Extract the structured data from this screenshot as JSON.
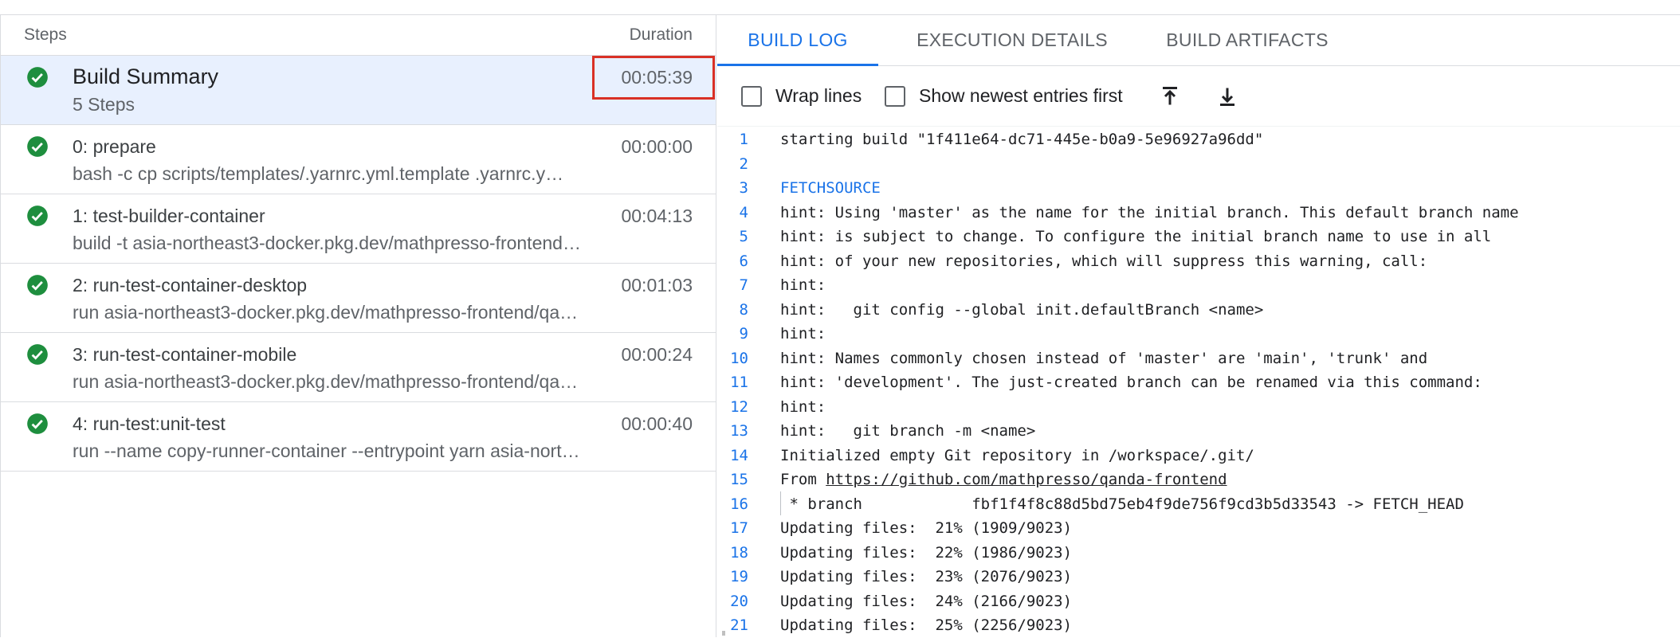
{
  "steps_panel": {
    "header_steps": "Steps",
    "header_duration": "Duration",
    "items": [
      {
        "title": "Build Summary",
        "sub": "5 Steps",
        "duration": "00:05:39"
      },
      {
        "title": "0: prepare",
        "sub": "bash -c cp scripts/templates/.yarnrc.yml.template .yarnrc.y…",
        "duration": "00:00:00"
      },
      {
        "title": "1: test-builder-container",
        "sub": "build -t asia-northeast3-docker.pkg.dev/mathpresso-frontend…",
        "duration": "00:04:13"
      },
      {
        "title": "2: run-test-container-desktop",
        "sub": "run asia-northeast3-docker.pkg.dev/mathpresso-frontend/qa…",
        "duration": "00:01:03"
      },
      {
        "title": "3: run-test-container-mobile",
        "sub": "run asia-northeast3-docker.pkg.dev/mathpresso-frontend/qa…",
        "duration": "00:00:24"
      },
      {
        "title": "4: run-test:unit-test",
        "sub": "run --name copy-runner-container --entrypoint yarn asia-north…",
        "duration": "00:00:40"
      }
    ]
  },
  "tabs": {
    "build_log": "BUILD LOG",
    "execution_details": "EXECUTION DETAILS",
    "build_artifacts": "BUILD ARTIFACTS"
  },
  "toolbar": {
    "wrap_lines": "Wrap lines",
    "show_newest": "Show newest entries first",
    "scroll_top_icon": "scroll-to-top-icon",
    "scroll_bottom_icon": "scroll-to-bottom-icon"
  },
  "log": {
    "lines": [
      {
        "n": "1",
        "text": "starting build \"1f411e64-dc71-445e-b0a9-5e96927a96dd\""
      },
      {
        "n": "2",
        "text": ""
      },
      {
        "n": "3",
        "text": "FETCHSOURCE"
      },
      {
        "n": "4",
        "text": "hint: Using 'master' as the name for the initial branch. This default branch name"
      },
      {
        "n": "5",
        "text": "hint: is subject to change. To configure the initial branch name to use in all"
      },
      {
        "n": "6",
        "text": "hint: of your new repositories, which will suppress this warning, call:"
      },
      {
        "n": "7",
        "text": "hint:"
      },
      {
        "n": "8",
        "text": "hint:   git config --global init.defaultBranch <name>"
      },
      {
        "n": "9",
        "text": "hint:"
      },
      {
        "n": "10",
        "text": "hint: Names commonly chosen instead of 'master' are 'main', 'trunk' and"
      },
      {
        "n": "11",
        "text": "hint: 'development'. The just-created branch can be renamed via this command:"
      },
      {
        "n": "12",
        "text": "hint:"
      },
      {
        "n": "13",
        "text": "hint:   git branch -m <name>"
      },
      {
        "n": "14",
        "text": "Initialized empty Git repository in /workspace/.git/"
      },
      {
        "n": "15",
        "text_prefix": "From ",
        "link": "https://github.com/mathpresso/qanda-frontend"
      },
      {
        "n": "16",
        "text": " * branch            fbf1f4f8c88d5bd75eb4f9de756f9cd3b5d33543 -> FETCH_HEAD"
      },
      {
        "n": "17",
        "text": "Updating files:  21% (1909/9023)"
      },
      {
        "n": "18",
        "text": "Updating files:  22% (1986/9023)"
      },
      {
        "n": "19",
        "text": "Updating files:  23% (2076/9023)"
      },
      {
        "n": "20",
        "text": "Updating files:  24% (2166/9023)"
      },
      {
        "n": "21",
        "text": "Updating files:  25% (2256/9023)"
      }
    ]
  },
  "colors": {
    "accent": "#1a73e8",
    "success": "#1e8e3e",
    "highlight_border": "#d93025",
    "selected_row": "#e8f0fe"
  }
}
